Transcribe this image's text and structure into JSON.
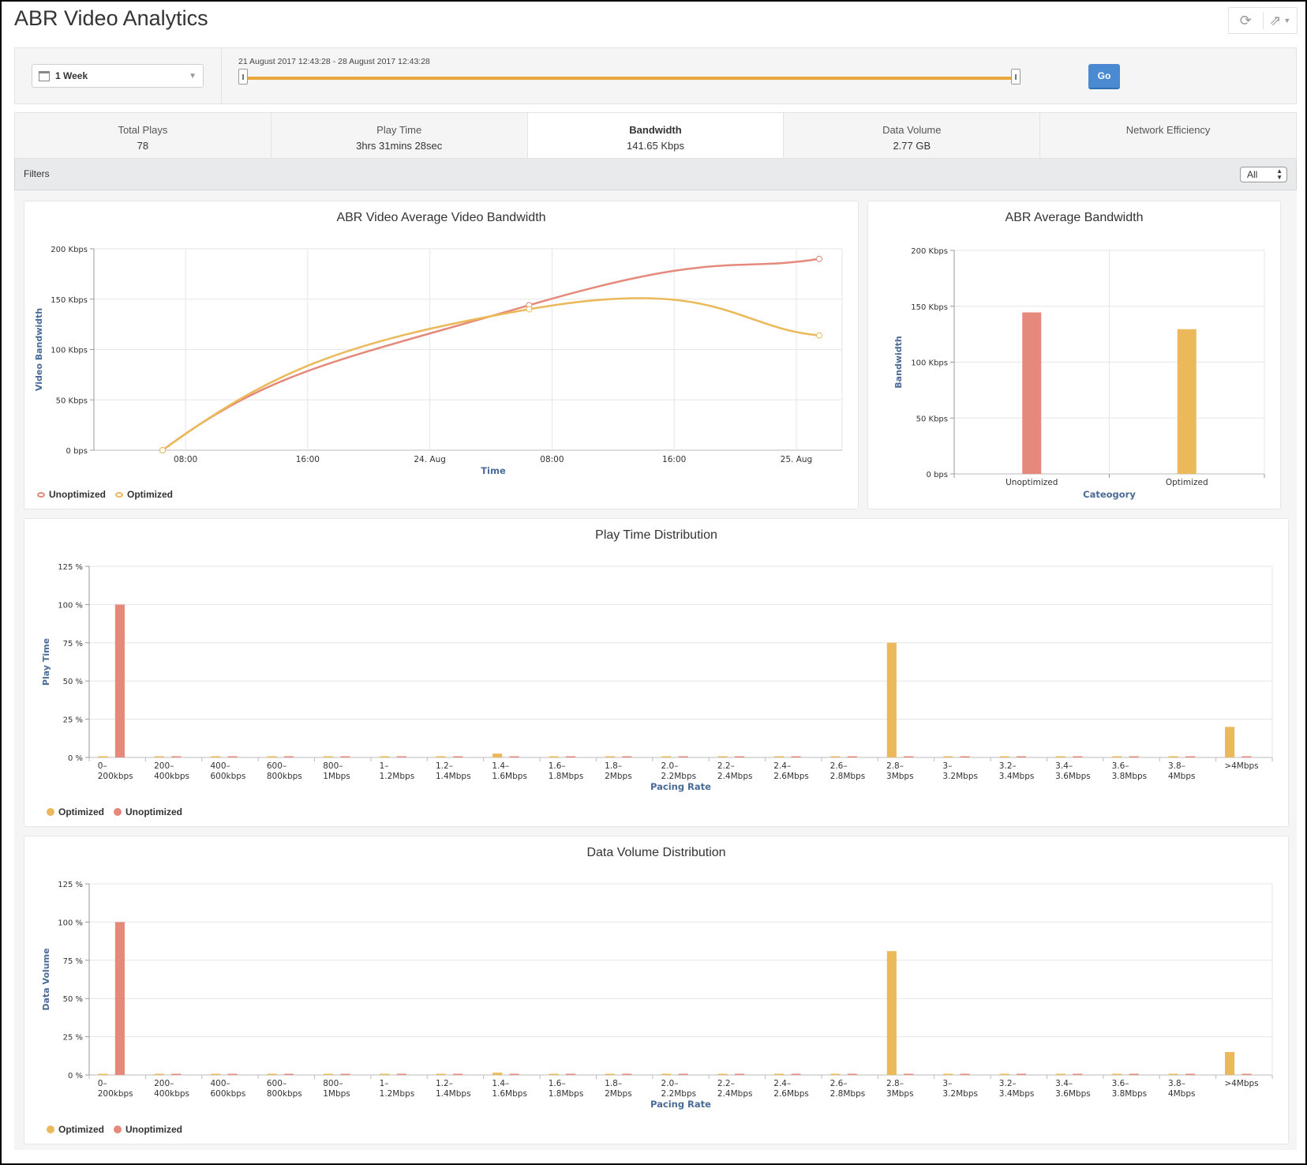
{
  "header": {
    "title": "ABR Video Analytics",
    "actions": [
      {
        "name": "refresh-icon",
        "glyph": "⟳"
      },
      {
        "name": "export-icon",
        "glyph": "⇗"
      }
    ]
  },
  "time_filter": {
    "period": "1 Week",
    "range_label": "21 August 2017 12:43:28 - 28 August 2017 12:43:28",
    "slider_start": 0,
    "slider_end": 1,
    "go_label": "Go"
  },
  "metrics": [
    {
      "label": "Total Plays",
      "value": "78",
      "active": false
    },
    {
      "label": "Play Time",
      "value": "3hrs 31mins 28sec",
      "active": false
    },
    {
      "label": "Bandwidth",
      "value": "141.65 Kbps",
      "active": true
    },
    {
      "label": "Data Volume",
      "value": "2.77 GB",
      "active": false
    },
    {
      "label": "Network Efficiency",
      "value": "",
      "active": false
    }
  ],
  "filters": {
    "label": "Filters",
    "selected": "All"
  },
  "colors": {
    "unoptimized": "#e5897b",
    "optimized": "#ebb95a",
    "axis_title": "#4a6b96"
  },
  "chart_data": [
    {
      "id": "avg-video-bandwidth",
      "type": "line",
      "title": "ABR Video Average Video Bandwidth",
      "xlabel": "Time",
      "ylabel": "Video Bandwidth",
      "y_ticks": [
        "0 bps",
        "50 Kbps",
        "100 Kbps",
        "150 Kbps",
        "200 Kbps"
      ],
      "ylim": [
        0,
        200
      ],
      "x_ticks": [
        "08:00",
        "16:00",
        "24. Aug",
        "08:00",
        "16:00",
        "25. Aug"
      ],
      "x_tick_hours": [
        8,
        16,
        24,
        32,
        40,
        48
      ],
      "xlim_hours": [
        2,
        51
      ],
      "grid": true,
      "legend": [
        "Unoptimized",
        "Optimized"
      ],
      "legend_position": "bottom-left",
      "series": [
        {
          "name": "Unoptimized",
          "x_hours": [
            6.5,
            30.5,
            49.5
          ],
          "values": [
            0,
            144,
            190
          ]
        },
        {
          "name": "Optimized",
          "x_hours": [
            6.5,
            30.5,
            49.5
          ],
          "values": [
            0,
            140,
            114
          ]
        }
      ]
    },
    {
      "id": "avg-bandwidth",
      "type": "bar",
      "title": "ABR Average Bandwidth",
      "xlabel": "Cateogory",
      "ylabel": "Bandwidth",
      "categories": [
        "Unoptimized",
        "Optimized"
      ],
      "values": [
        144.5,
        129.5
      ],
      "y_ticks": [
        "0 bps",
        "50 Kbps",
        "100 Kbps",
        "150 Kbps",
        "200 Kbps"
      ],
      "ylim": [
        0,
        200
      ],
      "grid": true
    },
    {
      "id": "play-time-distribution",
      "type": "bar",
      "title": "Play Time Distribution",
      "xlabel": "Pacing Rate",
      "ylabel": "Play Time",
      "y_ticks": [
        "0 %",
        "25 %",
        "50 %",
        "75 %",
        "100 %",
        "125 %"
      ],
      "ylim": [
        0,
        125
      ],
      "categories": [
        [
          "0–",
          "200kbps"
        ],
        [
          "200–",
          "400kbps"
        ],
        [
          "400–",
          "600kbps"
        ],
        [
          "600–",
          "800kbps"
        ],
        [
          "800–",
          "1Mbps"
        ],
        [
          "1–",
          "1.2Mbps"
        ],
        [
          "1.2–",
          "1.4Mbps"
        ],
        [
          "1.4–",
          "1.6Mbps"
        ],
        [
          "1.6–",
          "1.8Mbps"
        ],
        [
          "1.8–",
          "2Mbps"
        ],
        [
          "2.0–",
          "2.2Mbps"
        ],
        [
          "2.2–",
          "2.4Mbps"
        ],
        [
          "2.4–",
          "2.6Mbps"
        ],
        [
          "2.6–",
          "2.8Mbps"
        ],
        [
          "2.8–",
          "3Mbps"
        ],
        [
          "3–",
          "3.2Mbps"
        ],
        [
          "3.2–",
          "3.4Mbps"
        ],
        [
          "3.4–",
          "3.6Mbps"
        ],
        [
          "3.6–",
          "3.8Mbps"
        ],
        [
          "3.8–",
          "4Mbps"
        ],
        [
          ">4Mbps",
          ""
        ]
      ],
      "legend": [
        "Optimized",
        "Unoptimized"
      ],
      "legend_position": "bottom-left",
      "series": [
        {
          "name": "Optimized",
          "values": [
            0,
            0,
            0,
            0,
            0,
            0,
            0,
            2.5,
            0,
            0,
            0,
            0,
            0,
            0,
            75,
            0,
            0,
            0,
            0,
            0,
            20
          ]
        },
        {
          "name": "Unoptimized",
          "values": [
            100,
            0,
            0,
            0,
            0,
            0,
            0,
            0,
            0,
            0,
            0,
            0,
            0,
            0,
            0,
            0,
            0,
            0,
            0,
            0,
            0
          ]
        }
      ]
    },
    {
      "id": "data-volume-distribution",
      "type": "bar",
      "title": "Data Volume Distribution",
      "xlabel": "Pacing Rate",
      "ylabel": "Data Volume",
      "y_ticks": [
        "0 %",
        "25 %",
        "50 %",
        "75 %",
        "100 %",
        "125 %"
      ],
      "ylim": [
        0,
        125
      ],
      "categories": [
        [
          "0–",
          "200kbps"
        ],
        [
          "200–",
          "400kbps"
        ],
        [
          "400–",
          "600kbps"
        ],
        [
          "600–",
          "800kbps"
        ],
        [
          "800–",
          "1Mbps"
        ],
        [
          "1–",
          "1.2Mbps"
        ],
        [
          "1.2–",
          "1.4Mbps"
        ],
        [
          "1.4–",
          "1.6Mbps"
        ],
        [
          "1.6–",
          "1.8Mbps"
        ],
        [
          "1.8–",
          "2Mbps"
        ],
        [
          "2.0–",
          "2.2Mbps"
        ],
        [
          "2.2–",
          "2.4Mbps"
        ],
        [
          "2.4–",
          "2.6Mbps"
        ],
        [
          "2.6–",
          "2.8Mbps"
        ],
        [
          "2.8–",
          "3Mbps"
        ],
        [
          "3–",
          "3.2Mbps"
        ],
        [
          "3.2–",
          "3.4Mbps"
        ],
        [
          "3.4–",
          "3.6Mbps"
        ],
        [
          "3.6–",
          "3.8Mbps"
        ],
        [
          "3.8–",
          "4Mbps"
        ],
        [
          ">4Mbps",
          ""
        ]
      ],
      "legend": [
        "Optimized",
        "Unoptimized"
      ],
      "legend_position": "bottom-left",
      "series": [
        {
          "name": "Optimized",
          "values": [
            0,
            0,
            0,
            0,
            0,
            0,
            0,
            1.5,
            0,
            0,
            0,
            0,
            0,
            0,
            81,
            0,
            0,
            0,
            0,
            0,
            15
          ]
        },
        {
          "name": "Unoptimized",
          "values": [
            100,
            0,
            0,
            0,
            0,
            0,
            0,
            0,
            0,
            0,
            0,
            0,
            0,
            0,
            0,
            0,
            0,
            0,
            0,
            0,
            0
          ]
        }
      ]
    }
  ]
}
